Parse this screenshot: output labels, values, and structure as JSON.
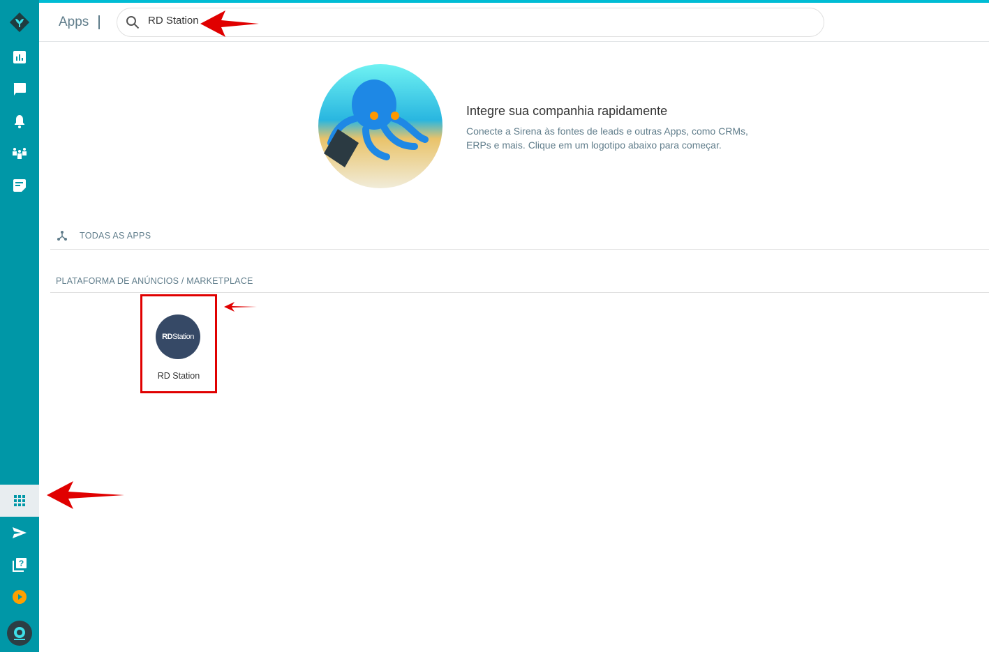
{
  "header": {
    "title": "Apps",
    "search_value": "RD Station"
  },
  "hero": {
    "title": "Integre sua companhia rapidamente",
    "description": "Conecte a Sirena às fontes de leads e outras Apps, como CRMs, ERPs e mais. Clique em um logotipo abaixo para começar."
  },
  "all_apps_label": "TODAS AS APPS",
  "category": {
    "label": "PLATAFORMA DE ANÚNCIOS / MARKETPLACE",
    "apps": [
      {
        "name": "RD Station",
        "logo_text_bold": "RD",
        "logo_text": "Station"
      }
    ]
  },
  "sidebar": {
    "items": [
      "logo",
      "dashboard-icon",
      "chat-icon",
      "bell-icon",
      "team-icon",
      "notes-icon",
      "apps-grid-icon",
      "send-icon",
      "help-icon",
      "play-icon",
      "avatar"
    ],
    "active": "apps-grid-icon"
  },
  "colors": {
    "sidebar": "#0097a7",
    "accent": "#00bcd4",
    "highlight": "#e00000",
    "logo_bg": "#364966"
  }
}
